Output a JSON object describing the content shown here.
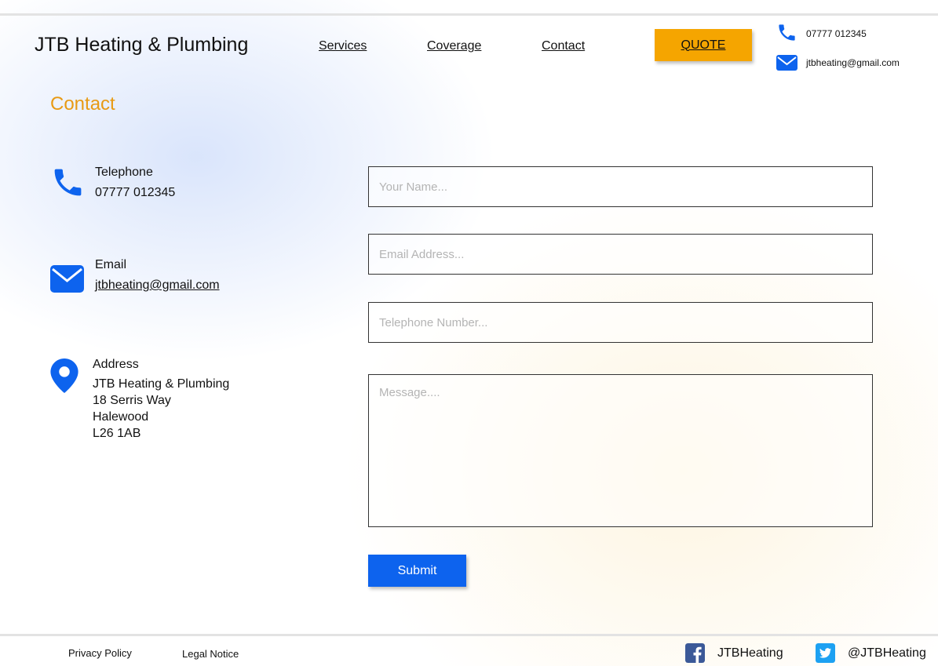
{
  "header": {
    "brand": "JTB Heating & Plumbing",
    "nav": [
      "Services",
      "Coverage",
      "Contact"
    ],
    "quote_label": "QUOTE",
    "phone": "07777 012345",
    "email": "jtbheating@gmail.com"
  },
  "page": {
    "title": "Contact"
  },
  "contact_info": {
    "telephone_label": "Telephone",
    "telephone_value": "07777 012345",
    "email_label": "Email",
    "email_value": "jtbheating@gmail.com",
    "address_label": "Address",
    "address_lines": [
      "JTB Heating & Plumbing",
      "18 Serris Way",
      "Halewood",
      "L26 1AB"
    ]
  },
  "form": {
    "name_placeholder": "Your Name...",
    "email_placeholder": "Email Address...",
    "phone_placeholder": "Telephone Number...",
    "message_placeholder": "Message....",
    "submit_label": "Submit"
  },
  "footer": {
    "privacy": "Privacy Policy",
    "legal": "Legal Notice",
    "facebook": "JTBHeating",
    "twitter": "@JTBHeating"
  },
  "colors": {
    "accent_orange": "#f5a500",
    "title_orange": "#e89a14",
    "primary_blue": "#0d63ee",
    "facebook_blue": "#3b5998",
    "twitter_blue": "#1da1f2"
  },
  "icons": [
    "phone-icon",
    "email-icon",
    "location-pin-icon",
    "facebook-icon",
    "twitter-icon"
  ]
}
